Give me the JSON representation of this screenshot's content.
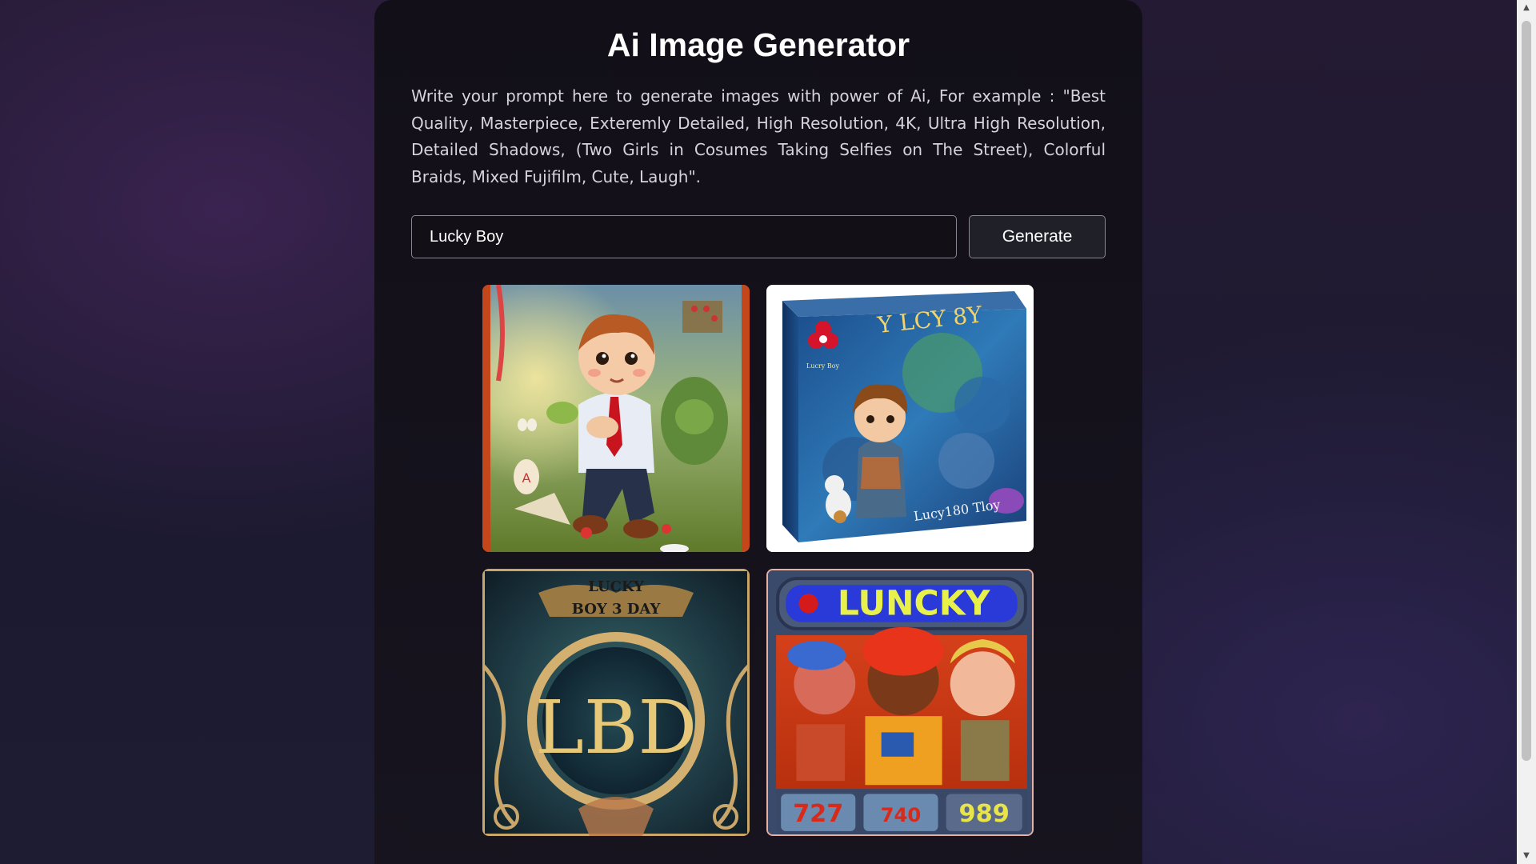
{
  "app": {
    "title": "Ai Image Generator",
    "description": "Write your prompt here to generate images with power of Ai, For example : \"Best Quality, Masterpiece, Exteremly Detailed, High Resolution, 4K, Ultra High Resolution, Detailed Shadows, (Two Girls in Cosumes Taking Selfies on The Street), Colorful Braids, Mixed Fujifilm, Cute, Laugh\"."
  },
  "prompt": {
    "value": "Lucky Boy"
  },
  "generate_button": {
    "label": "Generate"
  },
  "gallery": {
    "images": [
      {
        "subject": "cartoon boy in white shirt and red tie kneeling in a meadow",
        "text": ""
      },
      {
        "subject": "toy box with a cartoon boy figure",
        "text": "Y LCY 8Y",
        "footer": "Lucy180 Tloy",
        "box_text": "Lucry Boy"
      },
      {
        "subject": "ornate golden circular emblem",
        "text": "LUCKY BOY 3 DAY",
        "emblem": "LBD"
      },
      {
        "subject": "slot machine with cartoon characters",
        "text": "LUNCKY",
        "numbers": [
          "727",
          "740",
          "989"
        ]
      }
    ]
  },
  "scrollbar": {
    "up_arrow": "▲",
    "down_arrow": "▼"
  },
  "colors": {
    "background": "#1e1a2e",
    "card": "#141118",
    "title": "#ffffff",
    "description": "#d7d3dd",
    "input_border": "#8a8790",
    "button_bg": "#1f2028"
  }
}
